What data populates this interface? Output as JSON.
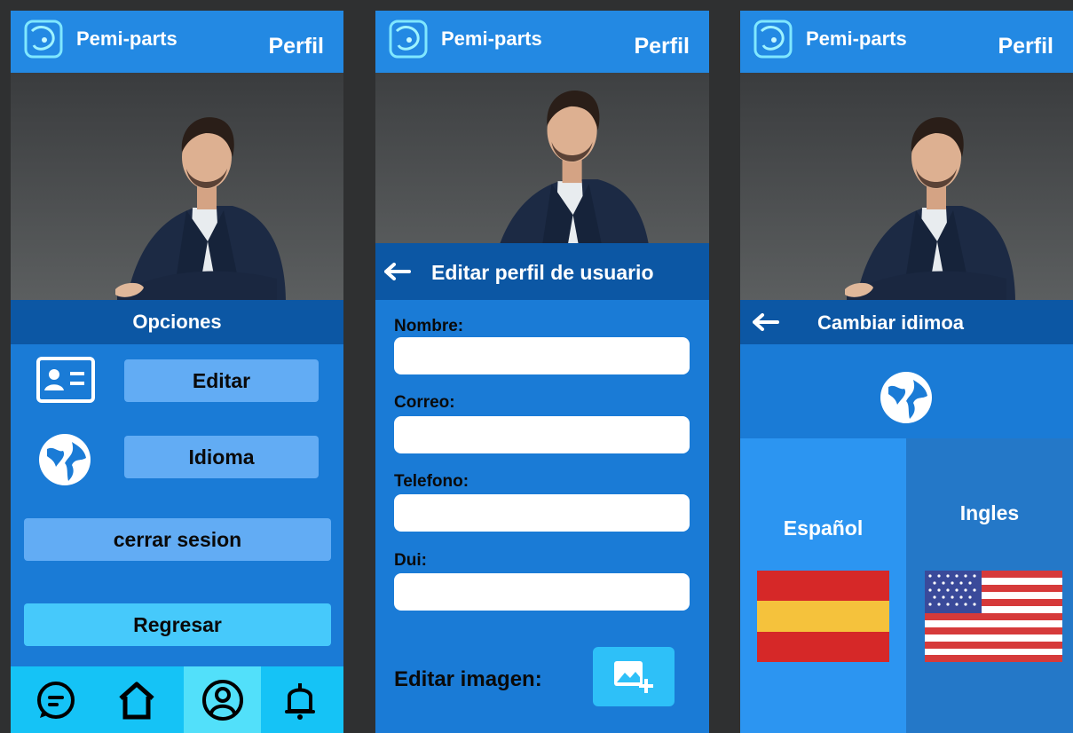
{
  "header": {
    "brand": "Pemi-parts",
    "title": "Perfil"
  },
  "colors": {
    "appbar": "#2389e3",
    "section_bar": "#0c57a4",
    "body": "#1a7bd6",
    "button_light": "#62acf4",
    "button_cyan": "#46c9fb",
    "navbar": "#15c3f6",
    "navbar_active": "#52e0fa"
  },
  "options_screen": {
    "section_title": "Opciones",
    "edit_label": "Editar",
    "language_label": "Idioma",
    "logout_label": "cerrar sesion",
    "back_label": "Regresar",
    "edit_icon": "id-card-icon",
    "language_icon": "globe-icon",
    "nav": [
      {
        "icon": "chat-icon"
      },
      {
        "icon": "home-icon"
      },
      {
        "icon": "profile-icon",
        "active": true
      },
      {
        "icon": "bell-icon"
      }
    ]
  },
  "edit_screen": {
    "section_title": "Editar perfil de usuario",
    "back_icon": "arrow-left-icon",
    "fields": [
      {
        "label": "Nombre:",
        "value": ""
      },
      {
        "label": "Correo:",
        "value": ""
      },
      {
        "label": "Telefono:",
        "value": ""
      },
      {
        "label": "Dui:",
        "value": ""
      }
    ],
    "edit_image_label": "Editar imagen:",
    "edit_image_icon": "add-image-icon"
  },
  "language_screen": {
    "section_title": "Cambiar idimoa",
    "back_icon": "arrow-left-icon",
    "globe_icon": "globe-icon",
    "spanish_label": "Español",
    "english_label": "Ingles",
    "spanish_flag": "spain-flag",
    "english_flag": "usa-flag"
  }
}
